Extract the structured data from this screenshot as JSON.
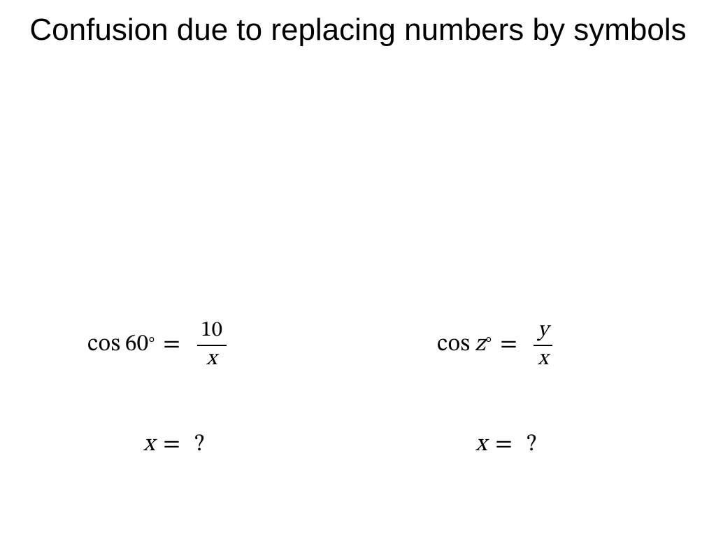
{
  "title": "Confusion due to replacing numbers by symbols",
  "equations": {
    "left_main": {
      "func": "cos",
      "angle_number": "60",
      "degree_symbol": "°",
      "equals": "=",
      "numerator": "10",
      "denominator": "x"
    },
    "right_main": {
      "func": "cos",
      "angle_variable": "z",
      "degree_symbol": "°",
      "equals": "=",
      "numerator": "y",
      "denominator": "x"
    },
    "left_question": {
      "variable": "x",
      "equals": "=",
      "mark": "?"
    },
    "right_question": {
      "variable": "x",
      "equals": "=",
      "mark": "?"
    }
  }
}
